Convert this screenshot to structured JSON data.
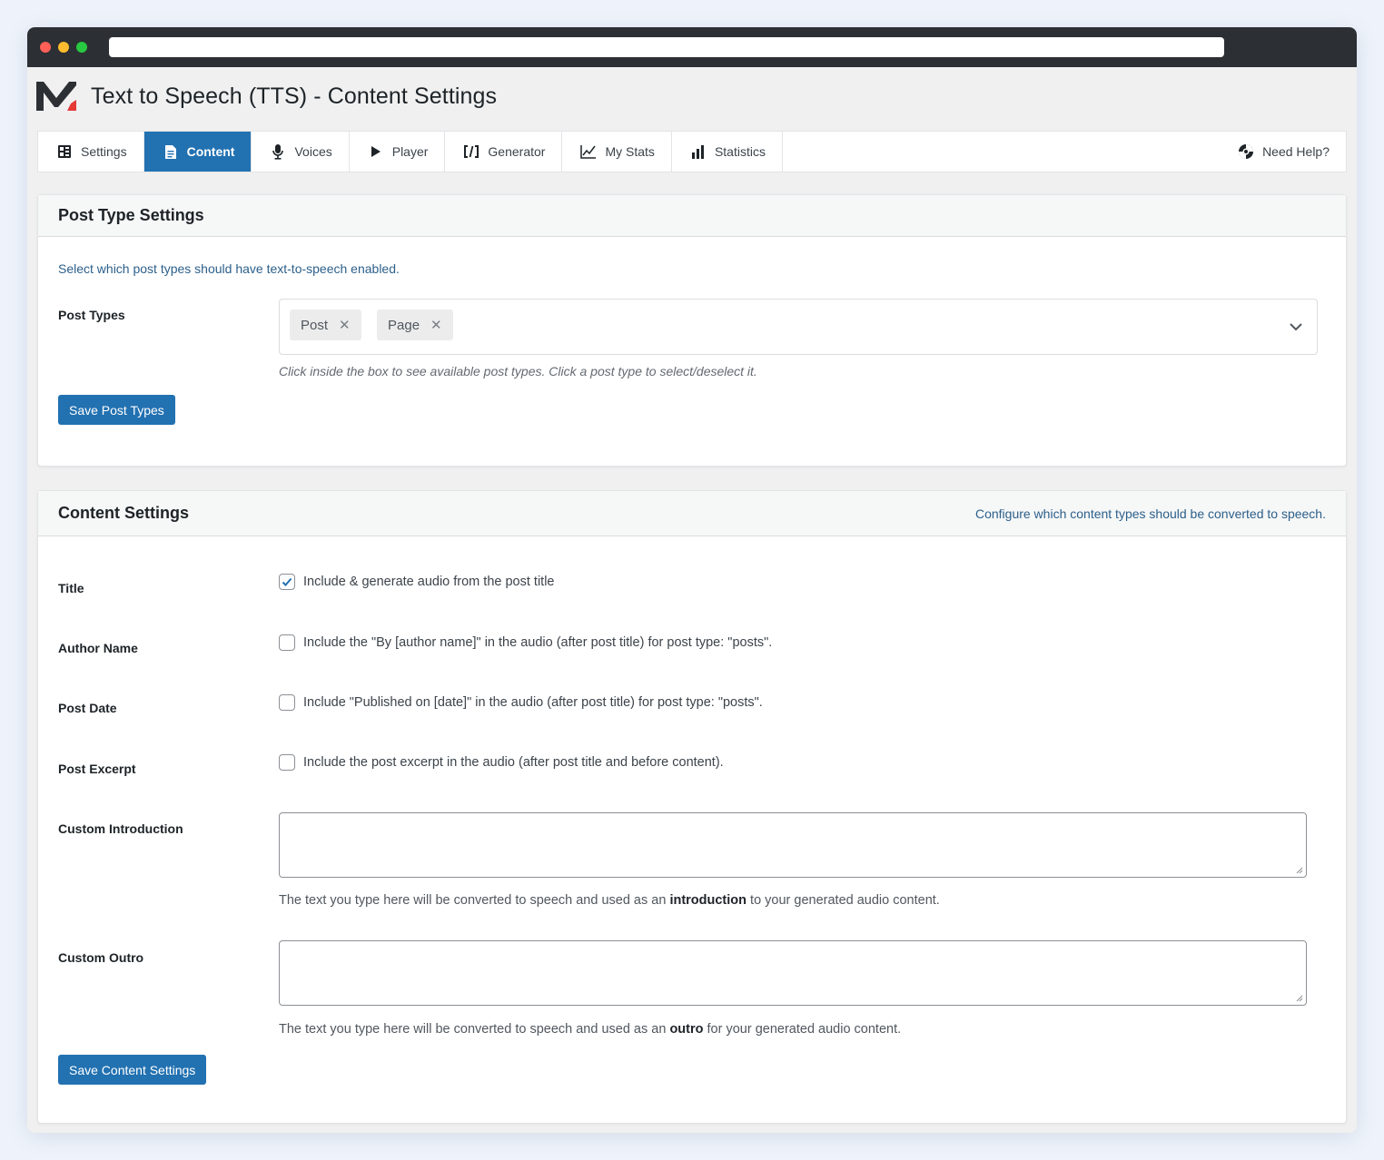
{
  "page": {
    "title": "Text to Speech (TTS) - Content Settings"
  },
  "tabs": [
    {
      "label": "Settings",
      "icon": "settings-grid-icon"
    },
    {
      "label": "Content",
      "icon": "document-icon",
      "active": true
    },
    {
      "label": "Voices",
      "icon": "microphone-icon"
    },
    {
      "label": "Player",
      "icon": "play-icon"
    },
    {
      "label": "Generator",
      "icon": "code-brackets-icon"
    },
    {
      "label": "My Stats",
      "icon": "line-chart-icon"
    },
    {
      "label": "Statistics",
      "icon": "bar-chart-icon"
    }
  ],
  "help": {
    "label": "Need Help?",
    "icon": "lifebuoy-icon"
  },
  "post_type_settings": {
    "title": "Post Type Settings",
    "description": "Select which post types should have text-to-speech enabled.",
    "label": "Post Types",
    "selected": [
      "Post",
      "Page"
    ],
    "remove_glyph": "✕",
    "hint": "Click inside the box to see available post types. Click a post type to select/deselect it.",
    "save_label": "Save Post Types"
  },
  "content_settings": {
    "title": "Content Settings",
    "description": "Configure which content types should be converted to speech.",
    "title_row": {
      "label": "Title",
      "text": "Include & generate audio from the post title",
      "checked": true
    },
    "author_row": {
      "label": "Author Name",
      "text": "Include the \"By [author name]\" in the audio (after post title) for post type: \"posts\".",
      "checked": false
    },
    "date_row": {
      "label": "Post Date",
      "text": "Include \"Published on [date]\" in the audio (after post title) for post type: \"posts\".",
      "checked": false
    },
    "excerpt_row": {
      "label": "Post Excerpt",
      "text": "Include the post excerpt in the audio (after post title and before content).",
      "checked": false
    },
    "intro": {
      "label": "Custom Introduction",
      "value": "",
      "help_before": "The text you type here will be converted to speech and used as an ",
      "help_bold": "introduction",
      "help_after": " to your generated audio content."
    },
    "outro": {
      "label": "Custom Outro",
      "value": "",
      "help_before": "The text you type here will be converted to speech and used as an ",
      "help_bold": "outro",
      "help_after": " for your generated audio content."
    },
    "save_label": "Save Content Settings"
  },
  "colors": {
    "accent": "#2271b1",
    "titlebar": "#2c2f33",
    "description": "#2c5f8a"
  }
}
